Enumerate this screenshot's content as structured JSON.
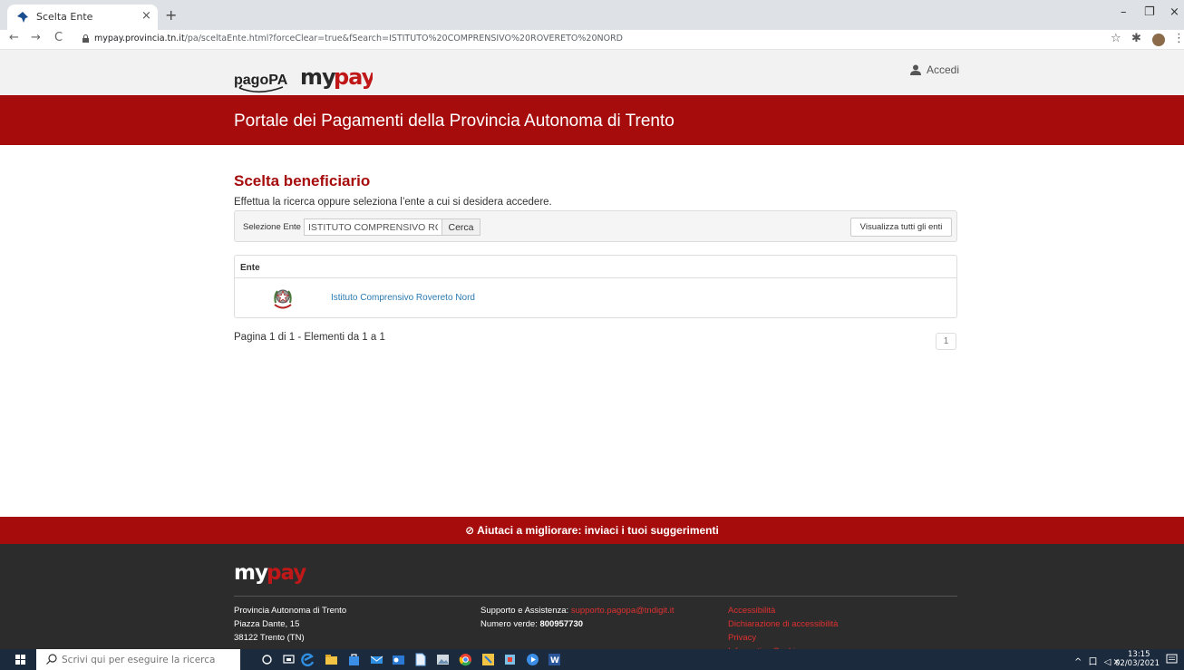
{
  "browser": {
    "tab_title": "Scelta Ente",
    "tab_close": "×",
    "new_tab": "+",
    "url_host": "mypay.provincia.tn.it",
    "url_path": "/pa/sceltaEnte.html?forceClear=true&fSearch=ISTITUTO%20COMPRENSIVO%20ROVERETO%20NORD",
    "nav_back": "←",
    "nav_forward": "→",
    "nav_reload": "C",
    "bookmark_star": "☆",
    "extensions": "✱",
    "menu": "⋮",
    "win_minimize": "–",
    "win_restore": "❐",
    "win_close": "×"
  },
  "header": {
    "logo_pagopa": "pagoPA",
    "logo_mypay": "mypay",
    "login_label": "Accedi",
    "portal_title": "Portale dei Pagamenti della Provincia Autonoma di Trento"
  },
  "main": {
    "heading": "Scelta beneficiario",
    "subheading": "Effettua la ricerca oppure seleziona l’ente a cui si desidera accedere.",
    "search": {
      "label": "Selezione Ente",
      "value": "ISTITUTO COMPRENSIVO ROVERETO NORD",
      "button": "Cerca",
      "show_all": "Visualizza tutti gli enti"
    },
    "table": {
      "column": "Ente",
      "rows": [
        {
          "name": "Istituto Comprensivo Rovereto Nord"
        }
      ]
    },
    "pagination": {
      "summary": "Pagina 1 di 1 - Elementi da 1 a 1",
      "current_page": "1"
    }
  },
  "footer": {
    "feedback": "⊘ Aiutaci a migliorare: inviaci i tuoi suggerimenti",
    "address": [
      "Provincia Autonoma di Trento",
      "Piazza Dante, 15",
      "38122 Trento (TN)"
    ],
    "support_label": "Supporto e Assistenza: ",
    "support_email": "supporto.pagopa@tndigit.it",
    "phone_label": "Numero verde: ",
    "phone_number": "800957730",
    "links": [
      "Accessibilità",
      "Dichiarazione di accessibilità",
      "Privacy",
      "Informativa Cookies"
    ]
  },
  "taskbar": {
    "search_placeholder": "Scrivi qui per eseguire la ricerca",
    "time": "13:15",
    "date": "02/03/2021",
    "tray_icons": "^ 口 ◁×"
  },
  "colors": {
    "brand_red": "#a60c0c",
    "link_blue": "#2a7ab0",
    "footer_dark": "#2c2c2c"
  }
}
